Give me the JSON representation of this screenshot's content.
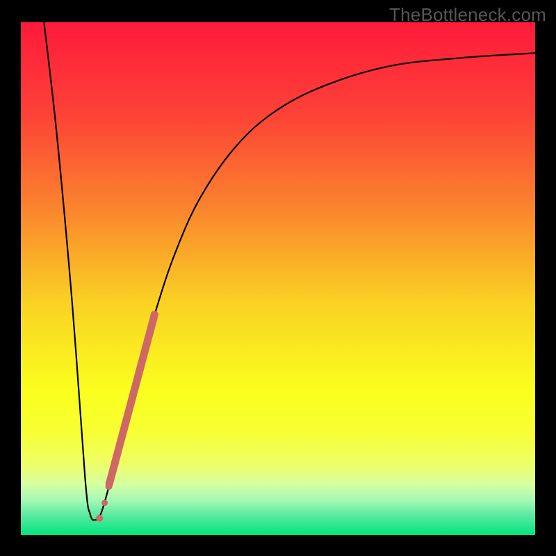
{
  "watermark": "TheBottleneck.com",
  "chart_data": {
    "type": "line",
    "title": "",
    "xlabel": "",
    "ylabel": "",
    "xlim": [
      0,
      100
    ],
    "ylim": [
      0,
      100
    ],
    "series": [
      {
        "name": "curve",
        "x": [
          4.5,
          7.0,
          10.0,
          12.5,
          13.5,
          14.5,
          15.5,
          17.0,
          19.0,
          22.0,
          26.0,
          30.0,
          35.0,
          42.0,
          50.0,
          60.0,
          72.0,
          85.0,
          100.0
        ],
        "y": [
          100.0,
          78.0,
          45.0,
          11.0,
          4.0,
          3.0,
          4.0,
          9.0,
          17.0,
          29.0,
          43.0,
          55.0,
          66.0,
          76.0,
          83.0,
          88.0,
          91.5,
          93.0,
          94.0
        ]
      }
    ],
    "highlight": {
      "comment": "coral emphasis segment and dots along the rising branch near the minimum",
      "line": {
        "x": [
          17.2,
          26.0
        ],
        "y": [
          10.0,
          43.0
        ]
      },
      "dots": [
        {
          "x": 15.3,
          "y": 3.3,
          "r": 5
        },
        {
          "x": 16.3,
          "y": 6.3,
          "r": 4.5
        },
        {
          "x": 17.1,
          "y": 9.5,
          "r": 5
        }
      ]
    },
    "background_gradient": {
      "stops": [
        {
          "pos": 0.0,
          "color": "#fe1a3a"
        },
        {
          "pos": 0.18,
          "color": "#fd4237"
        },
        {
          "pos": 0.35,
          "color": "#fb7f2e"
        },
        {
          "pos": 0.55,
          "color": "#fad323"
        },
        {
          "pos": 0.72,
          "color": "#faff1e"
        },
        {
          "pos": 0.8,
          "color": "#f7ff33"
        },
        {
          "pos": 0.86,
          "color": "#eeff66"
        },
        {
          "pos": 0.9,
          "color": "#d7ffa0"
        },
        {
          "pos": 0.93,
          "color": "#a8f9b4"
        },
        {
          "pos": 0.96,
          "color": "#5eeaa3"
        },
        {
          "pos": 1.0,
          "color": "#00e47c"
        }
      ]
    }
  }
}
